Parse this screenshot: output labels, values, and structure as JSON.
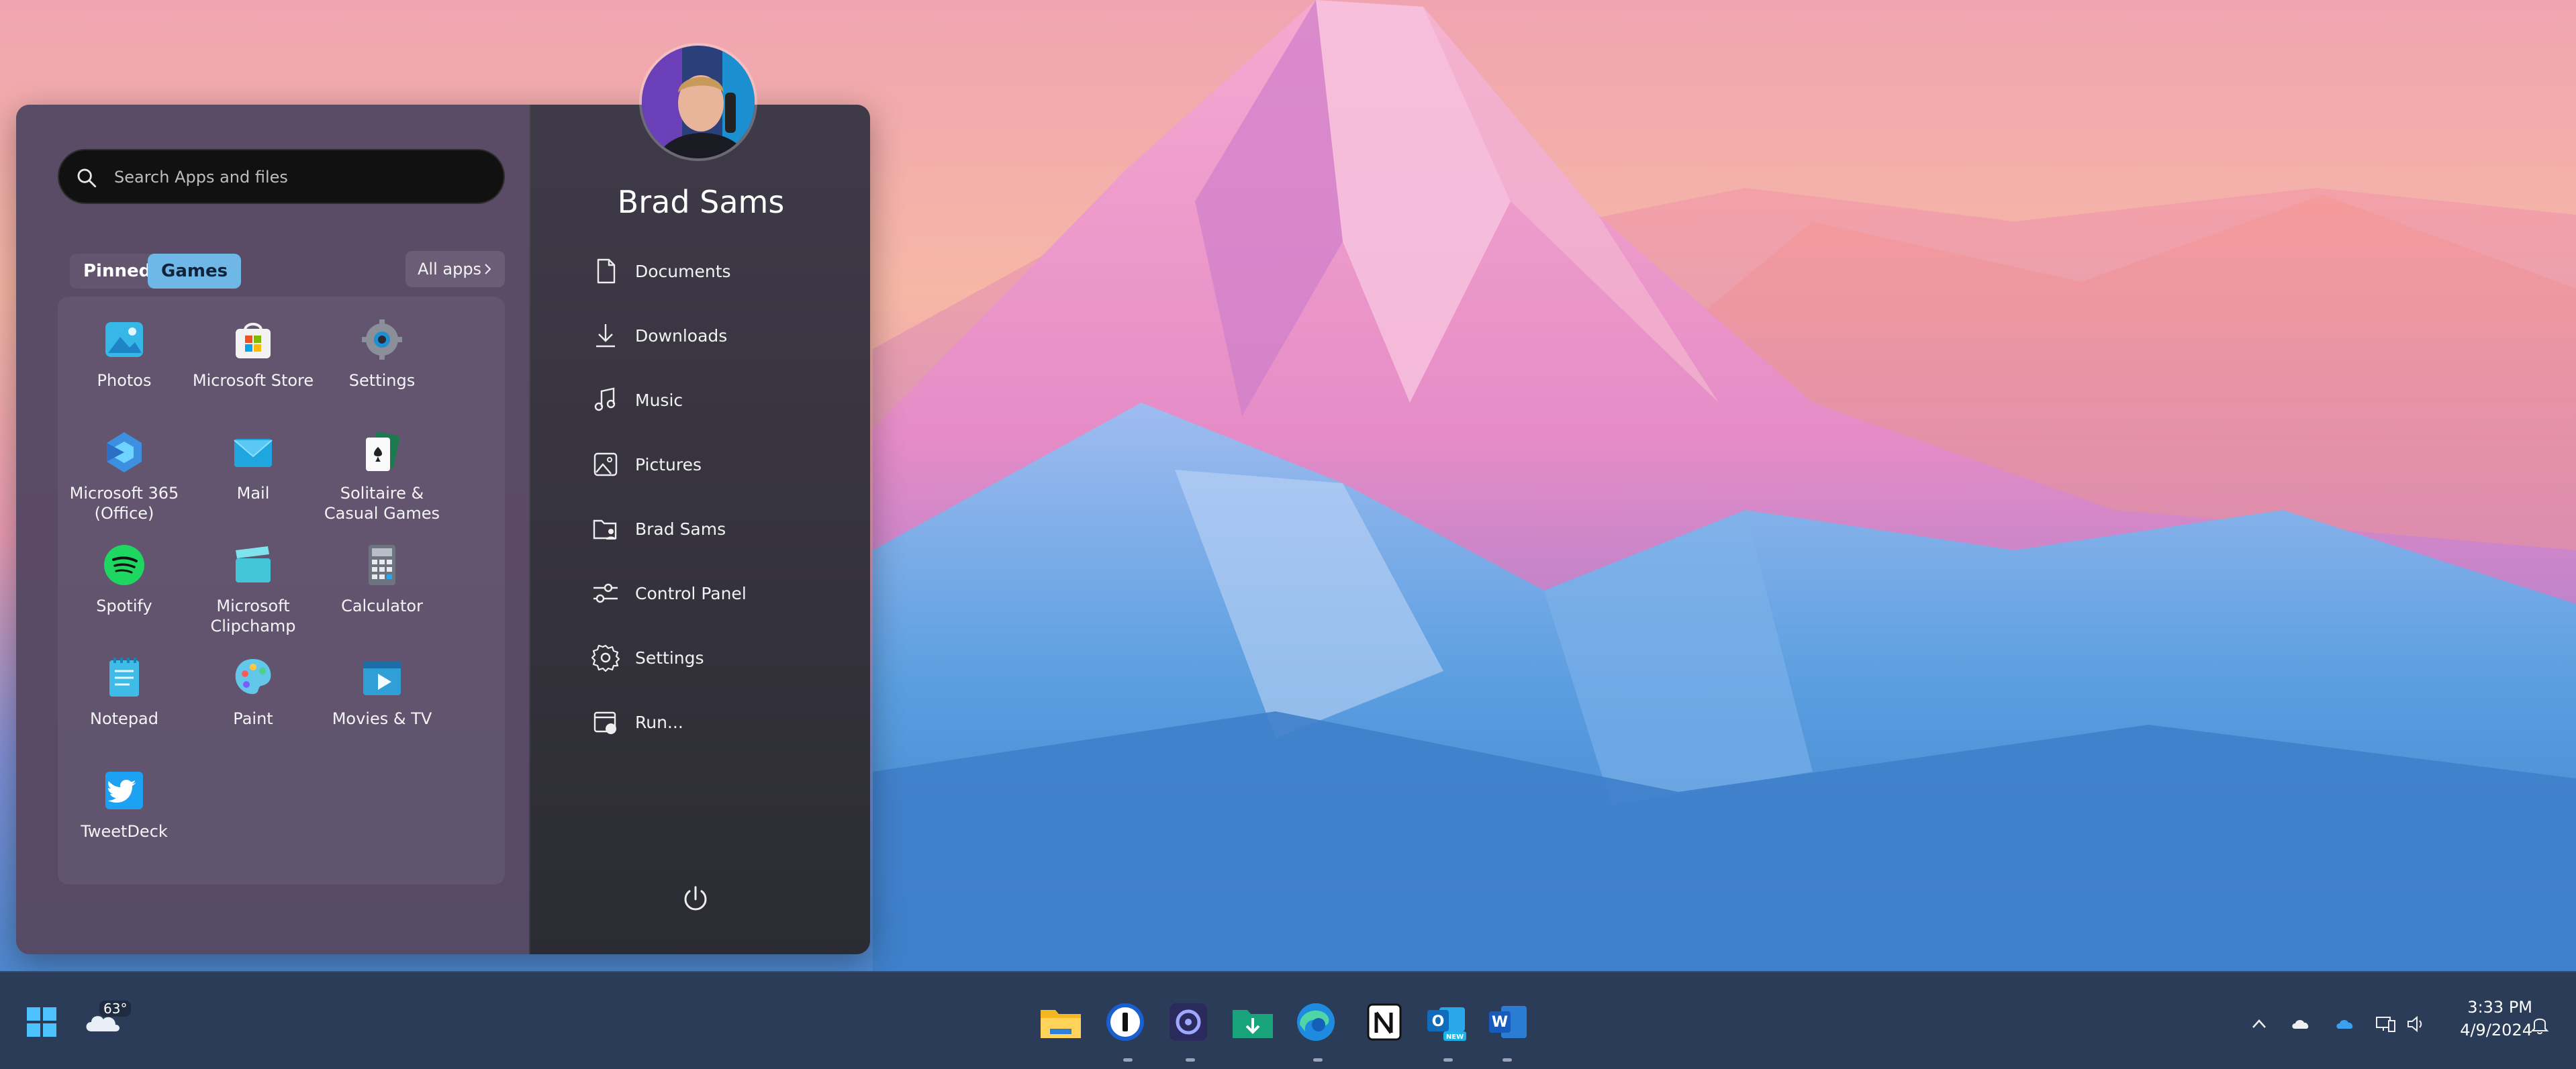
{
  "search": {
    "placeholder": "Search Apps and files"
  },
  "tabs": {
    "pinned": "Pinned",
    "games": "Games"
  },
  "all_apps_label": "All apps",
  "pinned_apps": [
    {
      "label": "Photos",
      "icon": "photos-icon"
    },
    {
      "label": "Microsoft Store",
      "icon": "store-icon"
    },
    {
      "label": "Settings",
      "icon": "gear-icon"
    },
    {
      "label": "Microsoft 365 (Office)",
      "icon": "office-icon"
    },
    {
      "label": "Mail",
      "icon": "mail-icon"
    },
    {
      "label": "Solitaire & Casual Games",
      "icon": "cards-icon"
    },
    {
      "label": "Spotify",
      "icon": "spotify-icon"
    },
    {
      "label": "Microsoft Clipchamp",
      "icon": "clipchamp-icon"
    },
    {
      "label": "Calculator",
      "icon": "calculator-icon"
    },
    {
      "label": "Notepad",
      "icon": "notepad-icon"
    },
    {
      "label": "Paint",
      "icon": "paint-icon"
    },
    {
      "label": "Movies & TV",
      "icon": "movies-icon"
    },
    {
      "label": "TweetDeck",
      "icon": "twitter-icon"
    }
  ],
  "user": {
    "name": "Brad Sams"
  },
  "places": [
    {
      "label": "Documents",
      "icon": "document-icon"
    },
    {
      "label": "Downloads",
      "icon": "download-icon"
    },
    {
      "label": "Music",
      "icon": "music-icon"
    },
    {
      "label": "Pictures",
      "icon": "picture-icon"
    },
    {
      "label": "Brad Sams",
      "icon": "user-folder-icon"
    },
    {
      "label": "Control Panel",
      "icon": "sliders-icon"
    },
    {
      "label": "Settings",
      "icon": "gear-icon"
    },
    {
      "label": "Run...",
      "icon": "run-icon"
    }
  ],
  "taskbar": {
    "weather_temp": "63°",
    "pinned": [
      "file-explorer-icon",
      "1password-icon",
      "obs-icon",
      "folder-download-icon",
      "edge-icon",
      "notion-icon",
      "outlook-new-icon",
      "word-icon"
    ],
    "clock": {
      "time": "3:33 PM",
      "date": "4/9/2024"
    }
  },
  "colors": {
    "accent": "#6fb7e6",
    "taskbar": "#2a3c58",
    "menu": "#4e425c"
  }
}
